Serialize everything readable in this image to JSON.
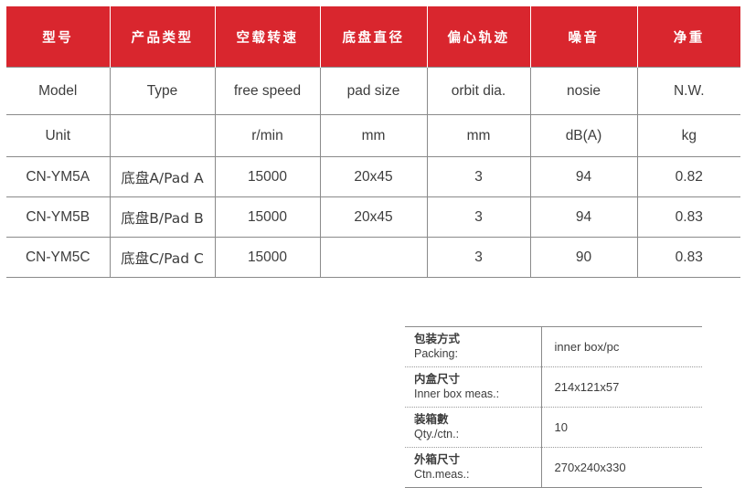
{
  "spec_table": {
    "header_color": "#d9262e",
    "header_text_color": "#ffffff",
    "grid_color": "#8a8a8a",
    "headers_cn": [
      "型号",
      "产品类型",
      "空载转速",
      "底盘直径",
      "偏心轨迹",
      "噪音",
      "净重"
    ],
    "rows": [
      {
        "kind": "label-en",
        "cells": [
          "Model",
          "Type",
          "free speed",
          "pad size",
          "orbit dia.",
          "nosie",
          "N.W."
        ]
      },
      {
        "kind": "unit",
        "cells": [
          "Unit",
          "",
          "r/min",
          "mm",
          "mm",
          "dB(A)",
          "kg"
        ]
      },
      {
        "kind": "data",
        "cells": [
          "CN-YM5A",
          "底盘A/Pad A",
          "15000",
          "20x45",
          "3",
          "94",
          "0.82"
        ]
      },
      {
        "kind": "data",
        "cells": [
          "CN-YM5B",
          "底盘B/Pad B",
          "15000",
          "20x45",
          "3",
          "94",
          "0.83"
        ]
      },
      {
        "kind": "data",
        "cells": [
          "CN-YM5C",
          "底盘C/Pad C",
          "15000",
          "",
          "3",
          "90",
          "0.83"
        ]
      }
    ]
  },
  "packing_table": {
    "rows": [
      {
        "label_cn": "包装方式",
        "label_en": "Packing:",
        "value": "inner box/pc"
      },
      {
        "label_cn": "内盒尺寸",
        "label_en": "Inner box meas.:",
        "value": "214x121x57"
      },
      {
        "label_cn": "装箱數",
        "label_en": "Qty./ctn.:",
        "value": "10"
      },
      {
        "label_cn": "外箱尺寸",
        "label_en": "Ctn.meas.:",
        "value": "270x240x330"
      }
    ]
  }
}
